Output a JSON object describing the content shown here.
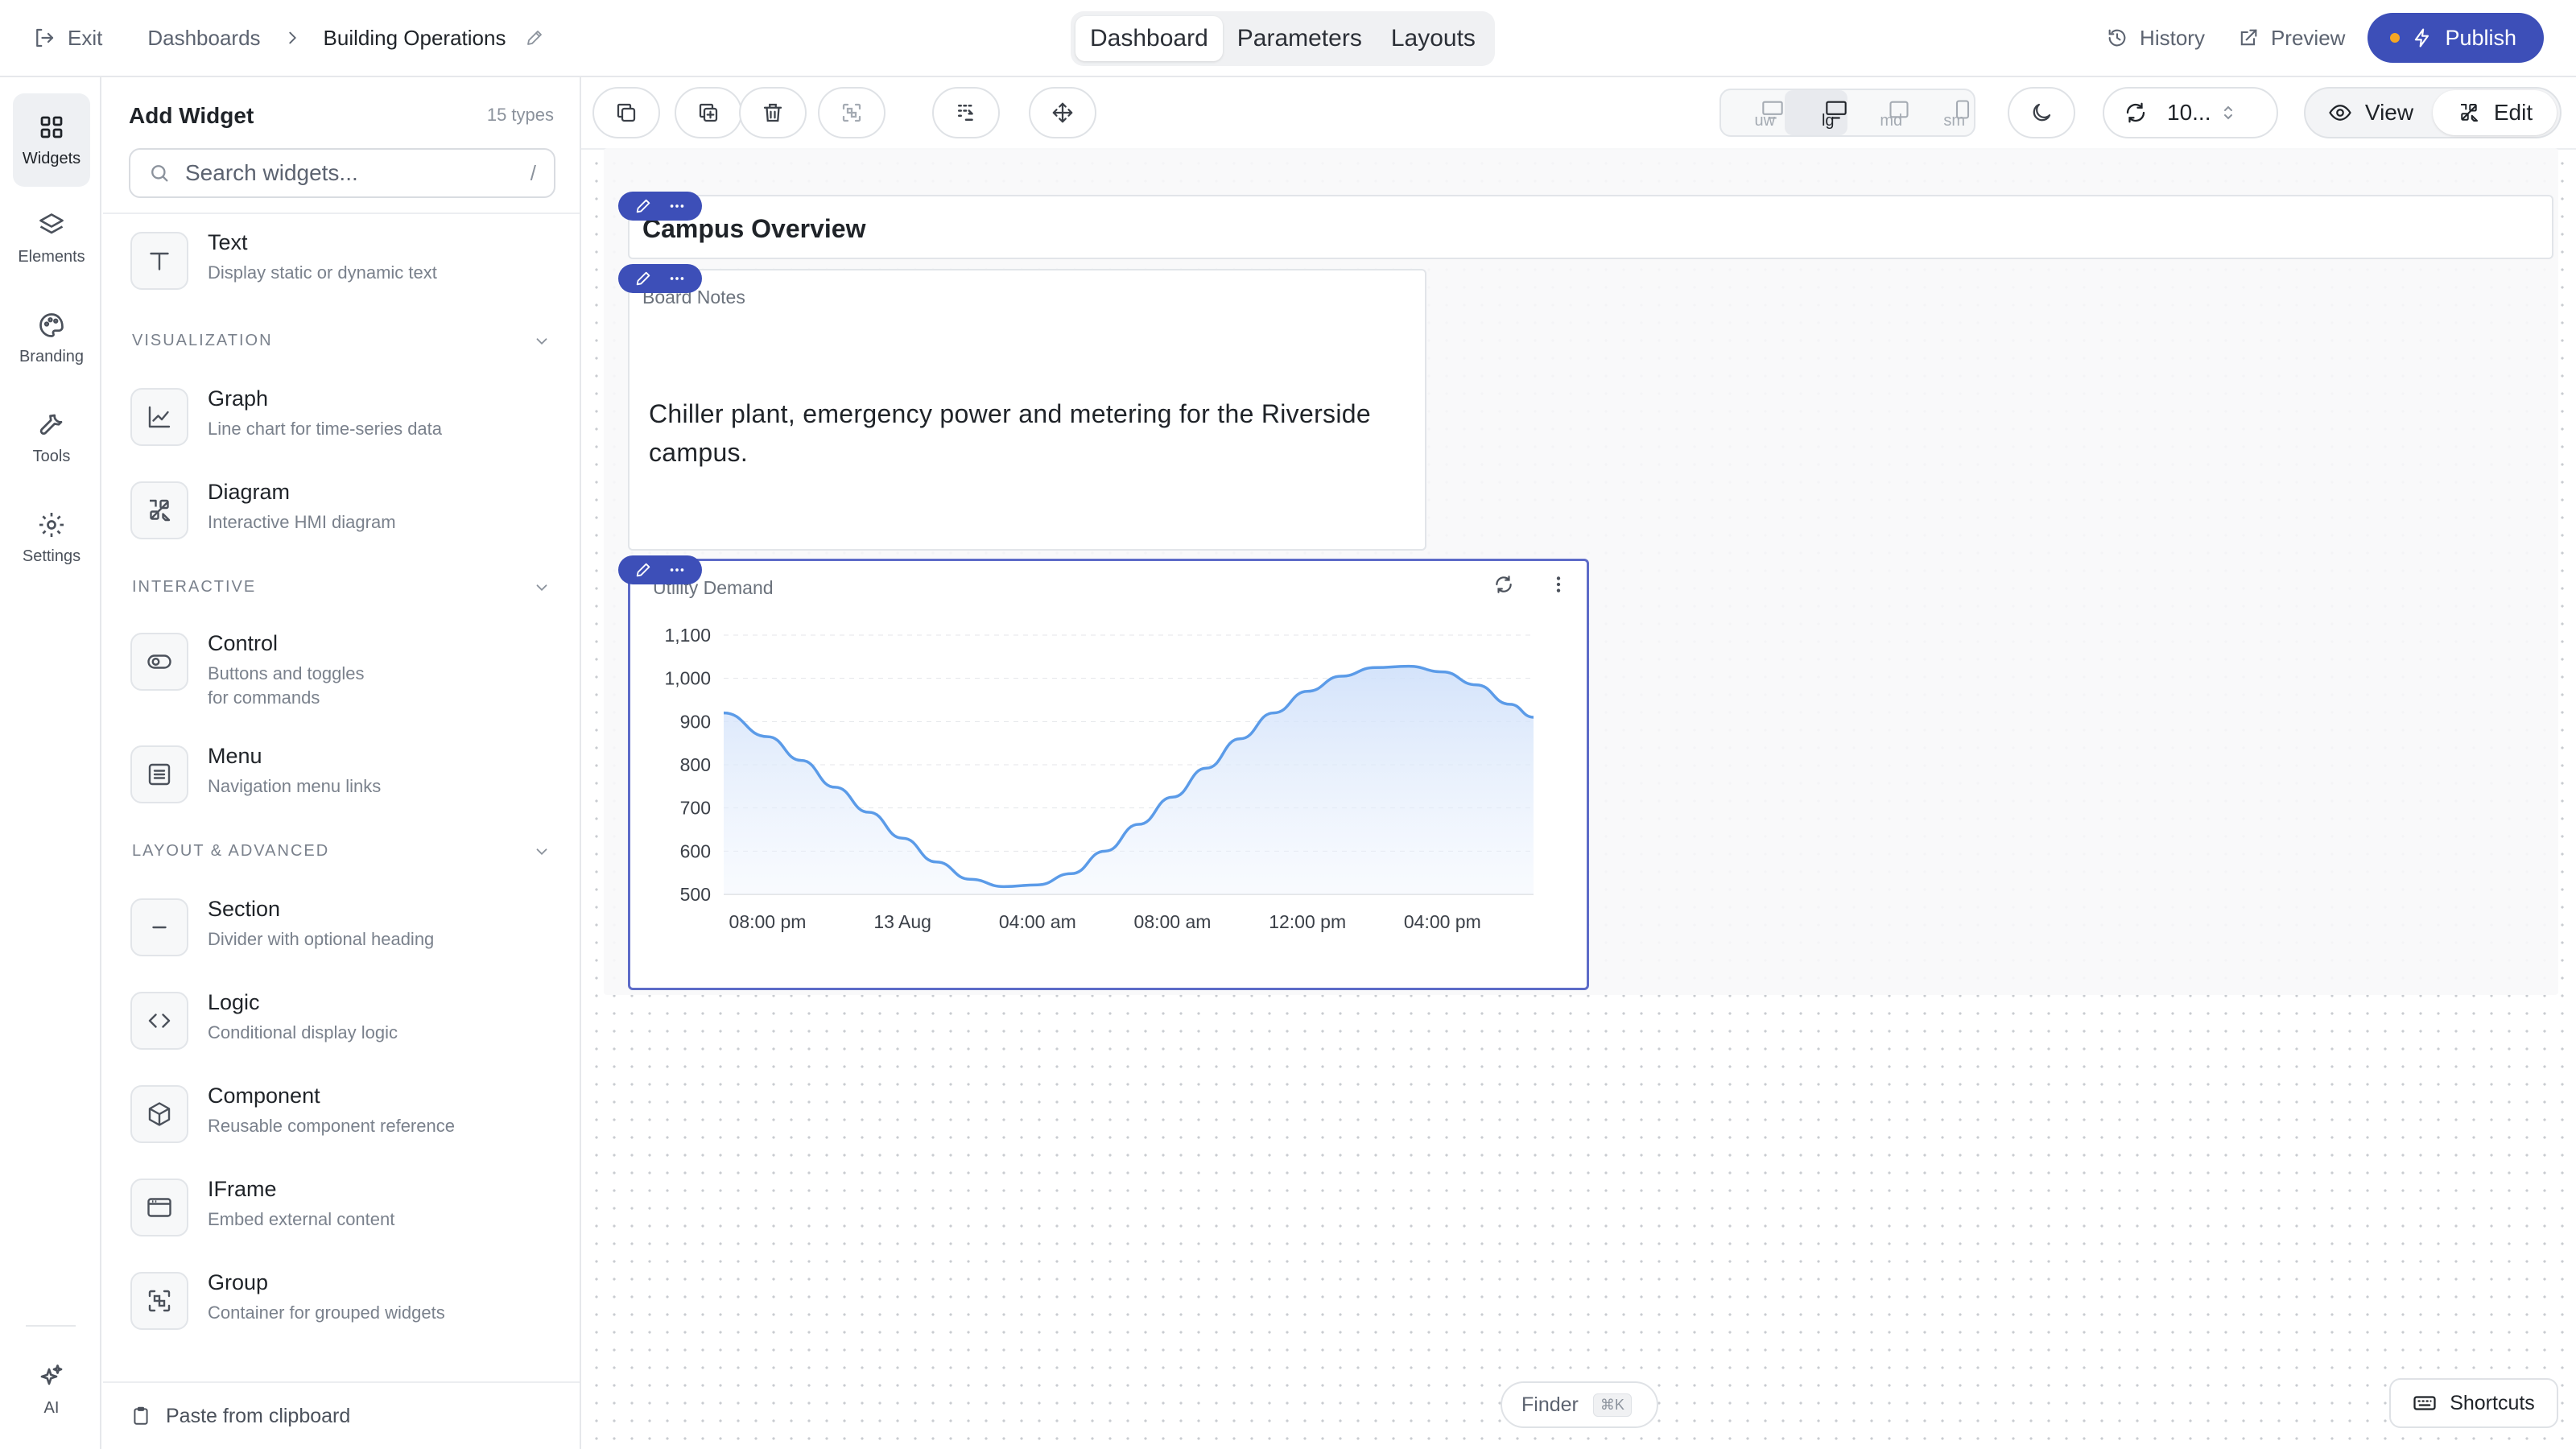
{
  "topbar": {
    "exit_label": "Exit",
    "breadcrumb_root": "Dashboards",
    "breadcrumb_current": "Building Operations",
    "modes": [
      "Dashboard",
      "Parameters",
      "Layouts"
    ],
    "active_mode": "Dashboard",
    "history_label": "History",
    "preview_label": "Preview",
    "publish_label": "Publish",
    "publish_dot_color": "#f5a623",
    "accent_color": "#3d4fb8"
  },
  "rail": {
    "items": [
      {
        "label": "Widgets",
        "icon": "grid-icon",
        "active": true
      },
      {
        "label": "Elements",
        "icon": "layers-icon"
      },
      {
        "label": "Branding",
        "icon": "palette-icon"
      },
      {
        "label": "Tools",
        "icon": "wrench-icon"
      },
      {
        "label": "Settings",
        "icon": "gear-icon"
      }
    ],
    "ai_label": "AI"
  },
  "panel": {
    "title": "Add Widget",
    "count": "15 types",
    "search_placeholder": "Search widgets...",
    "search_shortcut": "/",
    "text_widget": {
      "name": "Text",
      "desc": "Display static or dynamic text"
    },
    "sections": {
      "visualization": {
        "label": "VISUALIZATION",
        "items": [
          {
            "name": "Graph",
            "desc": "Line chart for time-series data"
          },
          {
            "name": "Diagram",
            "desc": "Interactive HMI diagram"
          }
        ]
      },
      "interactive": {
        "label": "INTERACTIVE",
        "items": [
          {
            "name": "Control",
            "desc_line1": "Buttons and toggles",
            "desc_line2": "for commands"
          },
          {
            "name": "Menu",
            "desc": "Navigation menu links"
          }
        ]
      },
      "layout": {
        "label": "LAYOUT & ADVANCED",
        "items": [
          {
            "name": "Section",
            "desc": "Divider with optional heading"
          },
          {
            "name": "Logic",
            "desc": "Conditional display logic"
          },
          {
            "name": "Component",
            "desc": "Reusable component reference"
          },
          {
            "name": "IFrame",
            "desc": "Embed external content"
          },
          {
            "name": "Group",
            "desc": "Container for grouped widgets"
          }
        ]
      }
    },
    "paste_label": "Paste from clipboard"
  },
  "toolbar": {
    "breakpoints": [
      "uw",
      "lg",
      "md",
      "sm"
    ],
    "active_breakpoint": "lg",
    "refresh_value": "10...",
    "view_label": "View",
    "edit_label": "Edit",
    "active_view": "Edit"
  },
  "canvas": {
    "title_widget": "Campus Overview",
    "notes_widget": {
      "label": "Board Notes",
      "text": "Chiller plant, emergency power and metering for the Riverside campus."
    },
    "chart_widget": {
      "label": "Utility Demand"
    }
  },
  "chart_data": {
    "type": "area",
    "title": "Utility Demand",
    "xlabel": "",
    "ylabel": "",
    "ylim": [
      500,
      1100
    ],
    "y_ticks": [
      "500",
      "600",
      "700",
      "800",
      "900",
      "1,000",
      "1,100"
    ],
    "x_tick_labels": [
      "08:00 pm",
      "13 Aug",
      "04:00 am",
      "08:00 am",
      "12:00 pm",
      "04:00 pm"
    ],
    "x_tick_hours": [
      20,
      24,
      28,
      32,
      36,
      40
    ],
    "x_range_hours": [
      18.7,
      42.7
    ],
    "grid": true,
    "line_color": "#5b9be8",
    "fill_color": "#dbe8fb",
    "series": [
      {
        "x_hours": [
          18.7,
          20,
          21,
          22,
          23,
          24,
          25,
          26,
          27,
          28,
          29,
          30,
          31,
          32,
          33,
          34,
          35,
          36,
          37,
          38,
          39,
          40,
          41,
          42,
          42.7
        ],
        "values": [
          920,
          865,
          810,
          748,
          690,
          630,
          575,
          535,
          518,
          522,
          548,
          600,
          662,
          725,
          792,
          860,
          920,
          970,
          1005,
          1025,
          1028,
          1015,
          985,
          940,
          910
        ]
      }
    ]
  },
  "bottom": {
    "finder_label": "Finder",
    "finder_shortcut": "⌘K",
    "shortcuts_label": "Shortcuts"
  }
}
